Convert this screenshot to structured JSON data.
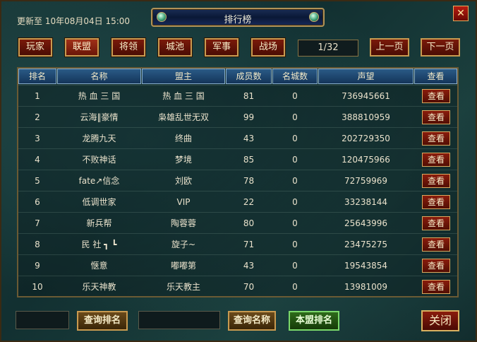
{
  "header": {
    "update_text": "更新至 10年08月04日 15:00",
    "title": "排行榜",
    "close_glyph": "✕"
  },
  "tabs": [
    {
      "label": "玩家",
      "active": false
    },
    {
      "label": "联盟",
      "active": true
    },
    {
      "label": "将领",
      "active": false
    },
    {
      "label": "城池",
      "active": false
    },
    {
      "label": "军事",
      "active": false
    },
    {
      "label": "战场",
      "active": false
    }
  ],
  "pagination": {
    "page": "1/32",
    "prev_label": "上一页",
    "next_label": "下一页"
  },
  "table": {
    "columns": [
      "排名",
      "名称",
      "盟主",
      "成员数",
      "名城数",
      "声望",
      "查看"
    ],
    "view_label": "查看",
    "rows": [
      {
        "rank": "1",
        "name": "热 血 三 国",
        "leader": "热 血 三 国",
        "members": "81",
        "cities": "0",
        "prestige": "736945661"
      },
      {
        "rank": "2",
        "name": "云海‖豪情",
        "leader": "枭雄乱世无双",
        "members": "99",
        "cities": "0",
        "prestige": "388810959"
      },
      {
        "rank": "3",
        "name": "龙腾九天",
        "leader": "终曲",
        "members": "43",
        "cities": "0",
        "prestige": "202729350"
      },
      {
        "rank": "4",
        "name": "不败神话",
        "leader": "梦境",
        "members": "85",
        "cities": "0",
        "prestige": "120475966"
      },
      {
        "rank": "5",
        "name": "fate↗信念",
        "leader": "刘欧",
        "members": "78",
        "cities": "0",
        "prestige": "72759969"
      },
      {
        "rank": "6",
        "name": "低调世家",
        "leader": "VIP",
        "members": "22",
        "cities": "0",
        "prestige": "33238144"
      },
      {
        "rank": "7",
        "name": "新兵帮",
        "leader": "陶蓉蓉",
        "members": "80",
        "cities": "0",
        "prestige": "25643996"
      },
      {
        "rank": "8",
        "name": "民 社 ┓ ┗",
        "leader": "旋子~",
        "members": "71",
        "cities": "0",
        "prestige": "23475275"
      },
      {
        "rank": "9",
        "name": "惬意",
        "leader": "嘟嘟第",
        "members": "43",
        "cities": "0",
        "prestige": "19543854"
      },
      {
        "rank": "10",
        "name": "乐天神教",
        "leader": "乐天教主",
        "members": "70",
        "cities": "0",
        "prestige": "13981009"
      }
    ]
  },
  "footer": {
    "rank_input_value": "",
    "query_rank_label": "查询排名",
    "name_input_value": "",
    "query_name_label": "查询名称",
    "my_alliance_label": "本盟排名",
    "close_label": "关闭"
  }
}
